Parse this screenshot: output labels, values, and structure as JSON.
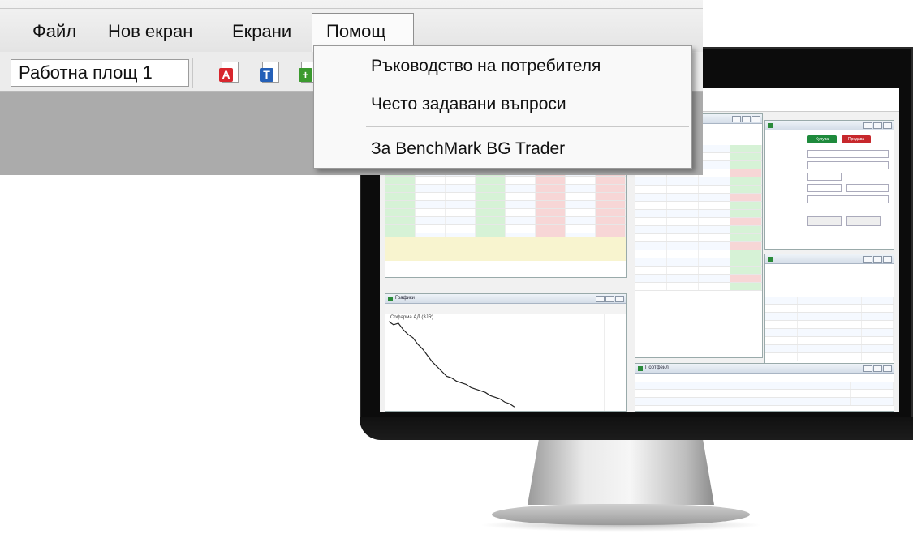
{
  "menubar": {
    "items": [
      "Файл",
      "Нов екран",
      "Екрани",
      "Помощ"
    ],
    "open_item": "Помощ"
  },
  "toolbar": {
    "workspace_tab": "Работна площ 1",
    "icons": [
      {
        "name": "new-table-icon",
        "letter": "A",
        "color": "#d8262d"
      },
      {
        "name": "new-text-icon",
        "letter": "T",
        "color": "#2460b8"
      },
      {
        "name": "add-icon",
        "letter": "+",
        "color": "#3b9a2e"
      }
    ]
  },
  "help_menu": {
    "items": [
      "Ръководство на потребителя",
      "Често задавани въпроси",
      "За BenchMark BG Trader"
    ]
  },
  "monitor_screen": {
    "order_panel": {
      "buy_label": "Купува",
      "sell_label": "Продава"
    },
    "chart_panel": {
      "title": "Графики",
      "instrument": "Софарма АД (3JR)"
    },
    "portfolio_panel": {
      "title": "Портфейл"
    }
  }
}
